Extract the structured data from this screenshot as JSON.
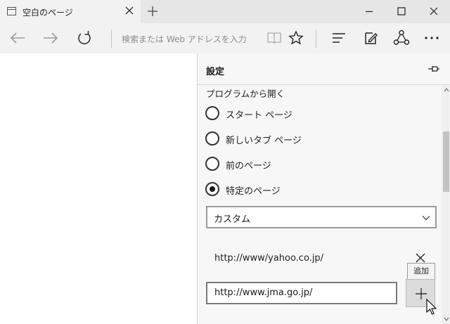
{
  "tab": {
    "title": "空白のページ"
  },
  "address_bar": {
    "placeholder": "検索または Web アドレスを入力"
  },
  "settings_panel": {
    "title": "設定",
    "open_with_label": "プログラムから開く",
    "options": [
      {
        "label": "スタート ページ",
        "selected": false
      },
      {
        "label": "新しいタブ ページ",
        "selected": false
      },
      {
        "label": "前のページ",
        "selected": false
      },
      {
        "label": "特定のページ",
        "selected": true
      }
    ],
    "page_select": {
      "value": "カスタム"
    },
    "custom_page_url": "http://www/yahoo.co.jp/",
    "new_page_input": {
      "value": "http://www.jma.go.jp/"
    },
    "add_tooltip": "追加"
  },
  "icons": [
    "tab-page-icon",
    "close-icon",
    "plus-icon",
    "minimize-icon",
    "maximize-icon",
    "window-close-icon",
    "back-icon",
    "forward-icon",
    "refresh-icon",
    "reading-view-icon",
    "favorite-star-icon",
    "hub-icon",
    "web-note-icon",
    "share-icon",
    "more-icon",
    "pin-icon",
    "chevron-down-icon",
    "remove-icon",
    "add-icon",
    "mouse-cursor-icon"
  ],
  "colors": {
    "titlebar": "#e6e6e6",
    "toolbar": "#f2f2f2",
    "panel": "#f7f7f7",
    "radio_selected": "#1a1a1a"
  }
}
